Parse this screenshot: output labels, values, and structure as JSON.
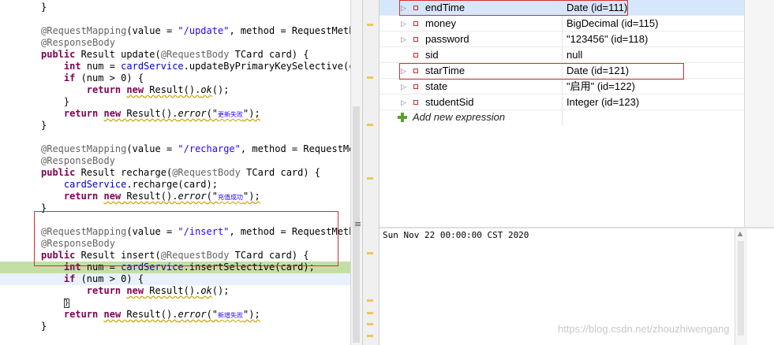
{
  "editor": {
    "lines": [
      {
        "id": "l0",
        "segments": [
          {
            "t": "}",
            "c": ""
          }
        ]
      },
      {
        "id": "l1",
        "segments": []
      },
      {
        "id": "l2",
        "segments": [
          {
            "t": "@RequestMapping",
            "c": "ann"
          },
          {
            "t": "(value = ",
            "c": ""
          },
          {
            "t": "\"/update\"",
            "c": "str"
          },
          {
            "t": ", method = RequestMetho",
            "c": ""
          }
        ]
      },
      {
        "id": "l3",
        "segments": [
          {
            "t": "@ResponseBody",
            "c": "ann"
          }
        ]
      },
      {
        "id": "l4",
        "segments": [
          {
            "t": "public",
            "c": "kw"
          },
          {
            "t": " Result update(",
            "c": ""
          },
          {
            "t": "@RequestBody",
            "c": "ann"
          },
          {
            "t": " TCard card) {",
            "c": ""
          }
        ]
      },
      {
        "id": "l5",
        "segments": [
          {
            "t": "    ",
            "c": ""
          },
          {
            "t": "int",
            "c": "kw"
          },
          {
            "t": " num = ",
            "c": ""
          },
          {
            "t": "cardService",
            "c": "fld"
          },
          {
            "t": ".updateByPrimaryKeySelective(ca",
            "c": ""
          }
        ]
      },
      {
        "id": "l6",
        "segments": [
          {
            "t": "    ",
            "c": ""
          },
          {
            "t": "if",
            "c": "kw"
          },
          {
            "t": " (num > 0) {",
            "c": ""
          }
        ]
      },
      {
        "id": "l7",
        "segments": [
          {
            "t": "        ",
            "c": ""
          },
          {
            "t": "return",
            "c": "kw"
          },
          {
            "t": " ",
            "c": ""
          },
          {
            "t": "new",
            "c": "kw sq"
          },
          {
            "t": " Result().",
            "c": "sq"
          },
          {
            "t": "ok",
            "c": "it sq"
          },
          {
            "t": "();",
            "c": ""
          }
        ]
      },
      {
        "id": "l8",
        "segments": [
          {
            "t": "    }",
            "c": ""
          }
        ]
      },
      {
        "id": "l9",
        "segments": [
          {
            "t": "    ",
            "c": ""
          },
          {
            "t": "return",
            "c": "kw"
          },
          {
            "t": " ",
            "c": ""
          },
          {
            "t": "new",
            "c": "kw sq"
          },
          {
            "t": " Result().",
            "c": "sq"
          },
          {
            "t": "error",
            "c": "it sq"
          },
          {
            "t": "(\"",
            "c": "sq"
          },
          {
            "t": "更新失败",
            "c": "cjk sq"
          },
          {
            "t": "\");",
            "c": "sq"
          }
        ]
      },
      {
        "id": "l10",
        "segments": [
          {
            "t": "}",
            "c": ""
          }
        ]
      },
      {
        "id": "l11",
        "segments": []
      },
      {
        "id": "l12",
        "segments": [
          {
            "t": "@RequestMapping",
            "c": "ann"
          },
          {
            "t": "(value = ",
            "c": ""
          },
          {
            "t": "\"/recharge\"",
            "c": "str"
          },
          {
            "t": ", method = RequestMet",
            "c": ""
          }
        ]
      },
      {
        "id": "l13",
        "segments": [
          {
            "t": "@ResponseBody",
            "c": "ann"
          }
        ]
      },
      {
        "id": "l14",
        "segments": [
          {
            "t": "public",
            "c": "kw"
          },
          {
            "t": " Result recharge(",
            "c": ""
          },
          {
            "t": "@RequestBody",
            "c": "ann"
          },
          {
            "t": " TCard card) {",
            "c": ""
          }
        ]
      },
      {
        "id": "l15",
        "segments": [
          {
            "t": "    ",
            "c": ""
          },
          {
            "t": "cardService",
            "c": "fld"
          },
          {
            "t": ".recharge(card);",
            "c": ""
          }
        ]
      },
      {
        "id": "l16",
        "segments": [
          {
            "t": "    ",
            "c": ""
          },
          {
            "t": "return",
            "c": "kw"
          },
          {
            "t": " ",
            "c": ""
          },
          {
            "t": "new",
            "c": "kw sq"
          },
          {
            "t": " Result().",
            "c": "sq"
          },
          {
            "t": "error",
            "c": "it sq"
          },
          {
            "t": "(\"",
            "c": "sq"
          },
          {
            "t": "充值成功",
            "c": "cjk sq"
          },
          {
            "t": "\");",
            "c": "sq"
          }
        ]
      },
      {
        "id": "l17",
        "segments": [
          {
            "t": "}",
            "c": ""
          }
        ]
      },
      {
        "id": "l18",
        "segments": []
      },
      {
        "id": "l19",
        "segments": [
          {
            "t": "@RequestMapping",
            "c": "ann"
          },
          {
            "t": "(value = ",
            "c": ""
          },
          {
            "t": "\"/insert\"",
            "c": "str"
          },
          {
            "t": ", method = RequestMetho",
            "c": ""
          }
        ]
      },
      {
        "id": "l20",
        "segments": [
          {
            "t": "@ResponseBody",
            "c": "ann"
          }
        ]
      },
      {
        "id": "l21",
        "segments": [
          {
            "t": "public",
            "c": "kw"
          },
          {
            "t": " Result insert(",
            "c": ""
          },
          {
            "t": "@RequestBody",
            "c": "ann"
          },
          {
            "t": " TCard card) {",
            "c": ""
          }
        ]
      },
      {
        "id": "l22",
        "hl": "green",
        "segments": [
          {
            "t": "    ",
            "c": ""
          },
          {
            "t": "int",
            "c": "kw"
          },
          {
            "t": " num = ",
            "c": ""
          },
          {
            "t": "cardService",
            "c": "fld"
          },
          {
            "t": ".insertSelective(card);",
            "c": ""
          }
        ]
      },
      {
        "id": "l23",
        "hl": "blue",
        "segments": [
          {
            "t": "    ",
            "c": ""
          },
          {
            "t": "if",
            "c": "kw"
          },
          {
            "t": " (num > 0) {",
            "c": ""
          }
        ]
      },
      {
        "id": "l24",
        "segments": [
          {
            "t": "        ",
            "c": ""
          },
          {
            "t": "return",
            "c": "kw"
          },
          {
            "t": " ",
            "c": ""
          },
          {
            "t": "new",
            "c": "kw sq"
          },
          {
            "t": " Result().",
            "c": "sq"
          },
          {
            "t": "ok",
            "c": "it sq"
          },
          {
            "t": "();",
            "c": ""
          }
        ]
      },
      {
        "id": "l25",
        "cursor": true,
        "segments": [
          {
            "t": "    ",
            "c": ""
          },
          {
            "t": "}",
            "c": ""
          }
        ]
      },
      {
        "id": "l26",
        "segments": [
          {
            "t": "    ",
            "c": ""
          },
          {
            "t": "return",
            "c": "kw"
          },
          {
            "t": " ",
            "c": ""
          },
          {
            "t": "new",
            "c": "kw sq"
          },
          {
            "t": " Result().",
            "c": "sq"
          },
          {
            "t": "error",
            "c": "it sq"
          },
          {
            "t": "(\"",
            "c": "sq"
          },
          {
            "t": "新增失败",
            "c": "cjk sq"
          },
          {
            "t": "\");",
            "c": "sq"
          }
        ]
      },
      {
        "id": "l27",
        "segments": [
          {
            "t": "}",
            "c": ""
          }
        ]
      }
    ]
  },
  "variables": {
    "rows": [
      {
        "name": "endTime",
        "value": "Date  (id=111)",
        "selected": true
      },
      {
        "name": "money",
        "value": "BigDecimal  (id=115)",
        "selected": false
      },
      {
        "name": "password",
        "value": "\"123456\" (id=118)",
        "selected": false
      },
      {
        "name": "sid",
        "value": "null",
        "selected": false,
        "noexpand": true
      },
      {
        "name": "starTime",
        "value": "Date  (id=121)",
        "selected": false
      },
      {
        "name": "state",
        "value": "\"启用\" (id=122)",
        "selected": false
      },
      {
        "name": "studentSid",
        "value": "Integer  (id=123)",
        "selected": false
      }
    ],
    "add_expression": "Add new expression"
  },
  "detail": {
    "text": "Sun Nov 22 00:00:00 CST 2020"
  },
  "watermark": "https://blog.csdn.net/zhouzhiwengang",
  "colors": {
    "annotation_box": "#d03030",
    "line_highlight": "#c4dfa5",
    "selected_row": "#d6e7fb"
  }
}
